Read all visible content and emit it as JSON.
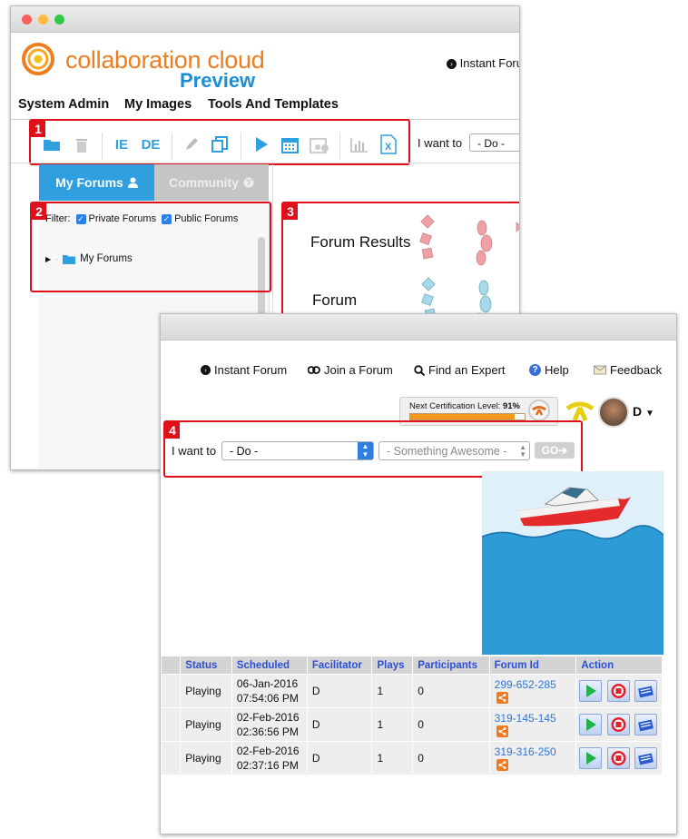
{
  "window1": {
    "logo": {
      "text": "collaboration cloud",
      "subtitle": "Preview"
    },
    "instant_forum_link": "Instant Foru",
    "menu": [
      "System Admin",
      "My Images",
      "Tools And Templates"
    ],
    "toolbar_icons": [
      "folder-icon",
      "trash-icon",
      "import-export-icon",
      "delete-export-icon",
      "pencil-icon",
      "copy-icon",
      "play-icon",
      "calendar-icon",
      "group-icon",
      "chart-icon",
      "excel-icon"
    ],
    "i_want_to": {
      "label": "I want to",
      "value": "- Do -"
    },
    "tabs": [
      {
        "label": "My Forums",
        "icon": "user-icon",
        "active": true
      },
      {
        "label": "Community",
        "icon": "globe-icon",
        "active": false
      }
    ],
    "filter": {
      "label": "Filter:",
      "options": [
        {
          "label": "Private Forums",
          "checked": true
        },
        {
          "label": "Public Forums",
          "checked": true
        }
      ]
    },
    "tree": [
      {
        "label": "My Forums"
      }
    ],
    "canvas_labels": [
      "Forum Results",
      "Forum"
    ],
    "callouts": [
      "1",
      "2",
      "3"
    ]
  },
  "window2": {
    "nav": [
      {
        "label": "Instant Forum",
        "icon": "arrow-circle-icon"
      },
      {
        "label": "Join a Forum",
        "icon": "link-icon"
      },
      {
        "label": "Find an Expert",
        "icon": "search-icon"
      },
      {
        "label": "Help",
        "icon": "help-icon"
      },
      {
        "label": "Feedback",
        "icon": "envelope-icon"
      }
    ],
    "certification": {
      "label": "Next Certification Level:",
      "percent_text": "91%",
      "progress": 0.91
    },
    "user": {
      "initial": "D"
    },
    "callout": "4",
    "i_want_to": {
      "label": "I want to",
      "value": "- Do -",
      "second": "- Something Awesome -",
      "go": "GO"
    },
    "table": {
      "headers": [
        "",
        "Status",
        "Scheduled",
        "Facilitator",
        "Plays",
        "Participants",
        "Forum Id",
        "Action"
      ],
      "rows": [
        {
          "status": "Playing",
          "date": "06-Jan-2016",
          "time": "07:54:06 PM",
          "facilitator": "D",
          "plays": "1",
          "participants": "0",
          "forum_id": "299-652-285"
        },
        {
          "status": "Playing",
          "date": "02-Feb-2016",
          "time": "02:36:56 PM",
          "facilitator": "D",
          "plays": "1",
          "participants": "0",
          "forum_id": "319-145-145"
        },
        {
          "status": "Playing",
          "date": "02-Feb-2016",
          "time": "02:37:16 PM",
          "facilitator": "D",
          "plays": "1",
          "participants": "0",
          "forum_id": "319-316-250"
        }
      ]
    }
  },
  "colors": {
    "brand_orange": "#ef7d1e",
    "brand_blue": "#1a8fd8",
    "callout_red": "#e0101a",
    "tab_blue": "#2f9fdf"
  }
}
